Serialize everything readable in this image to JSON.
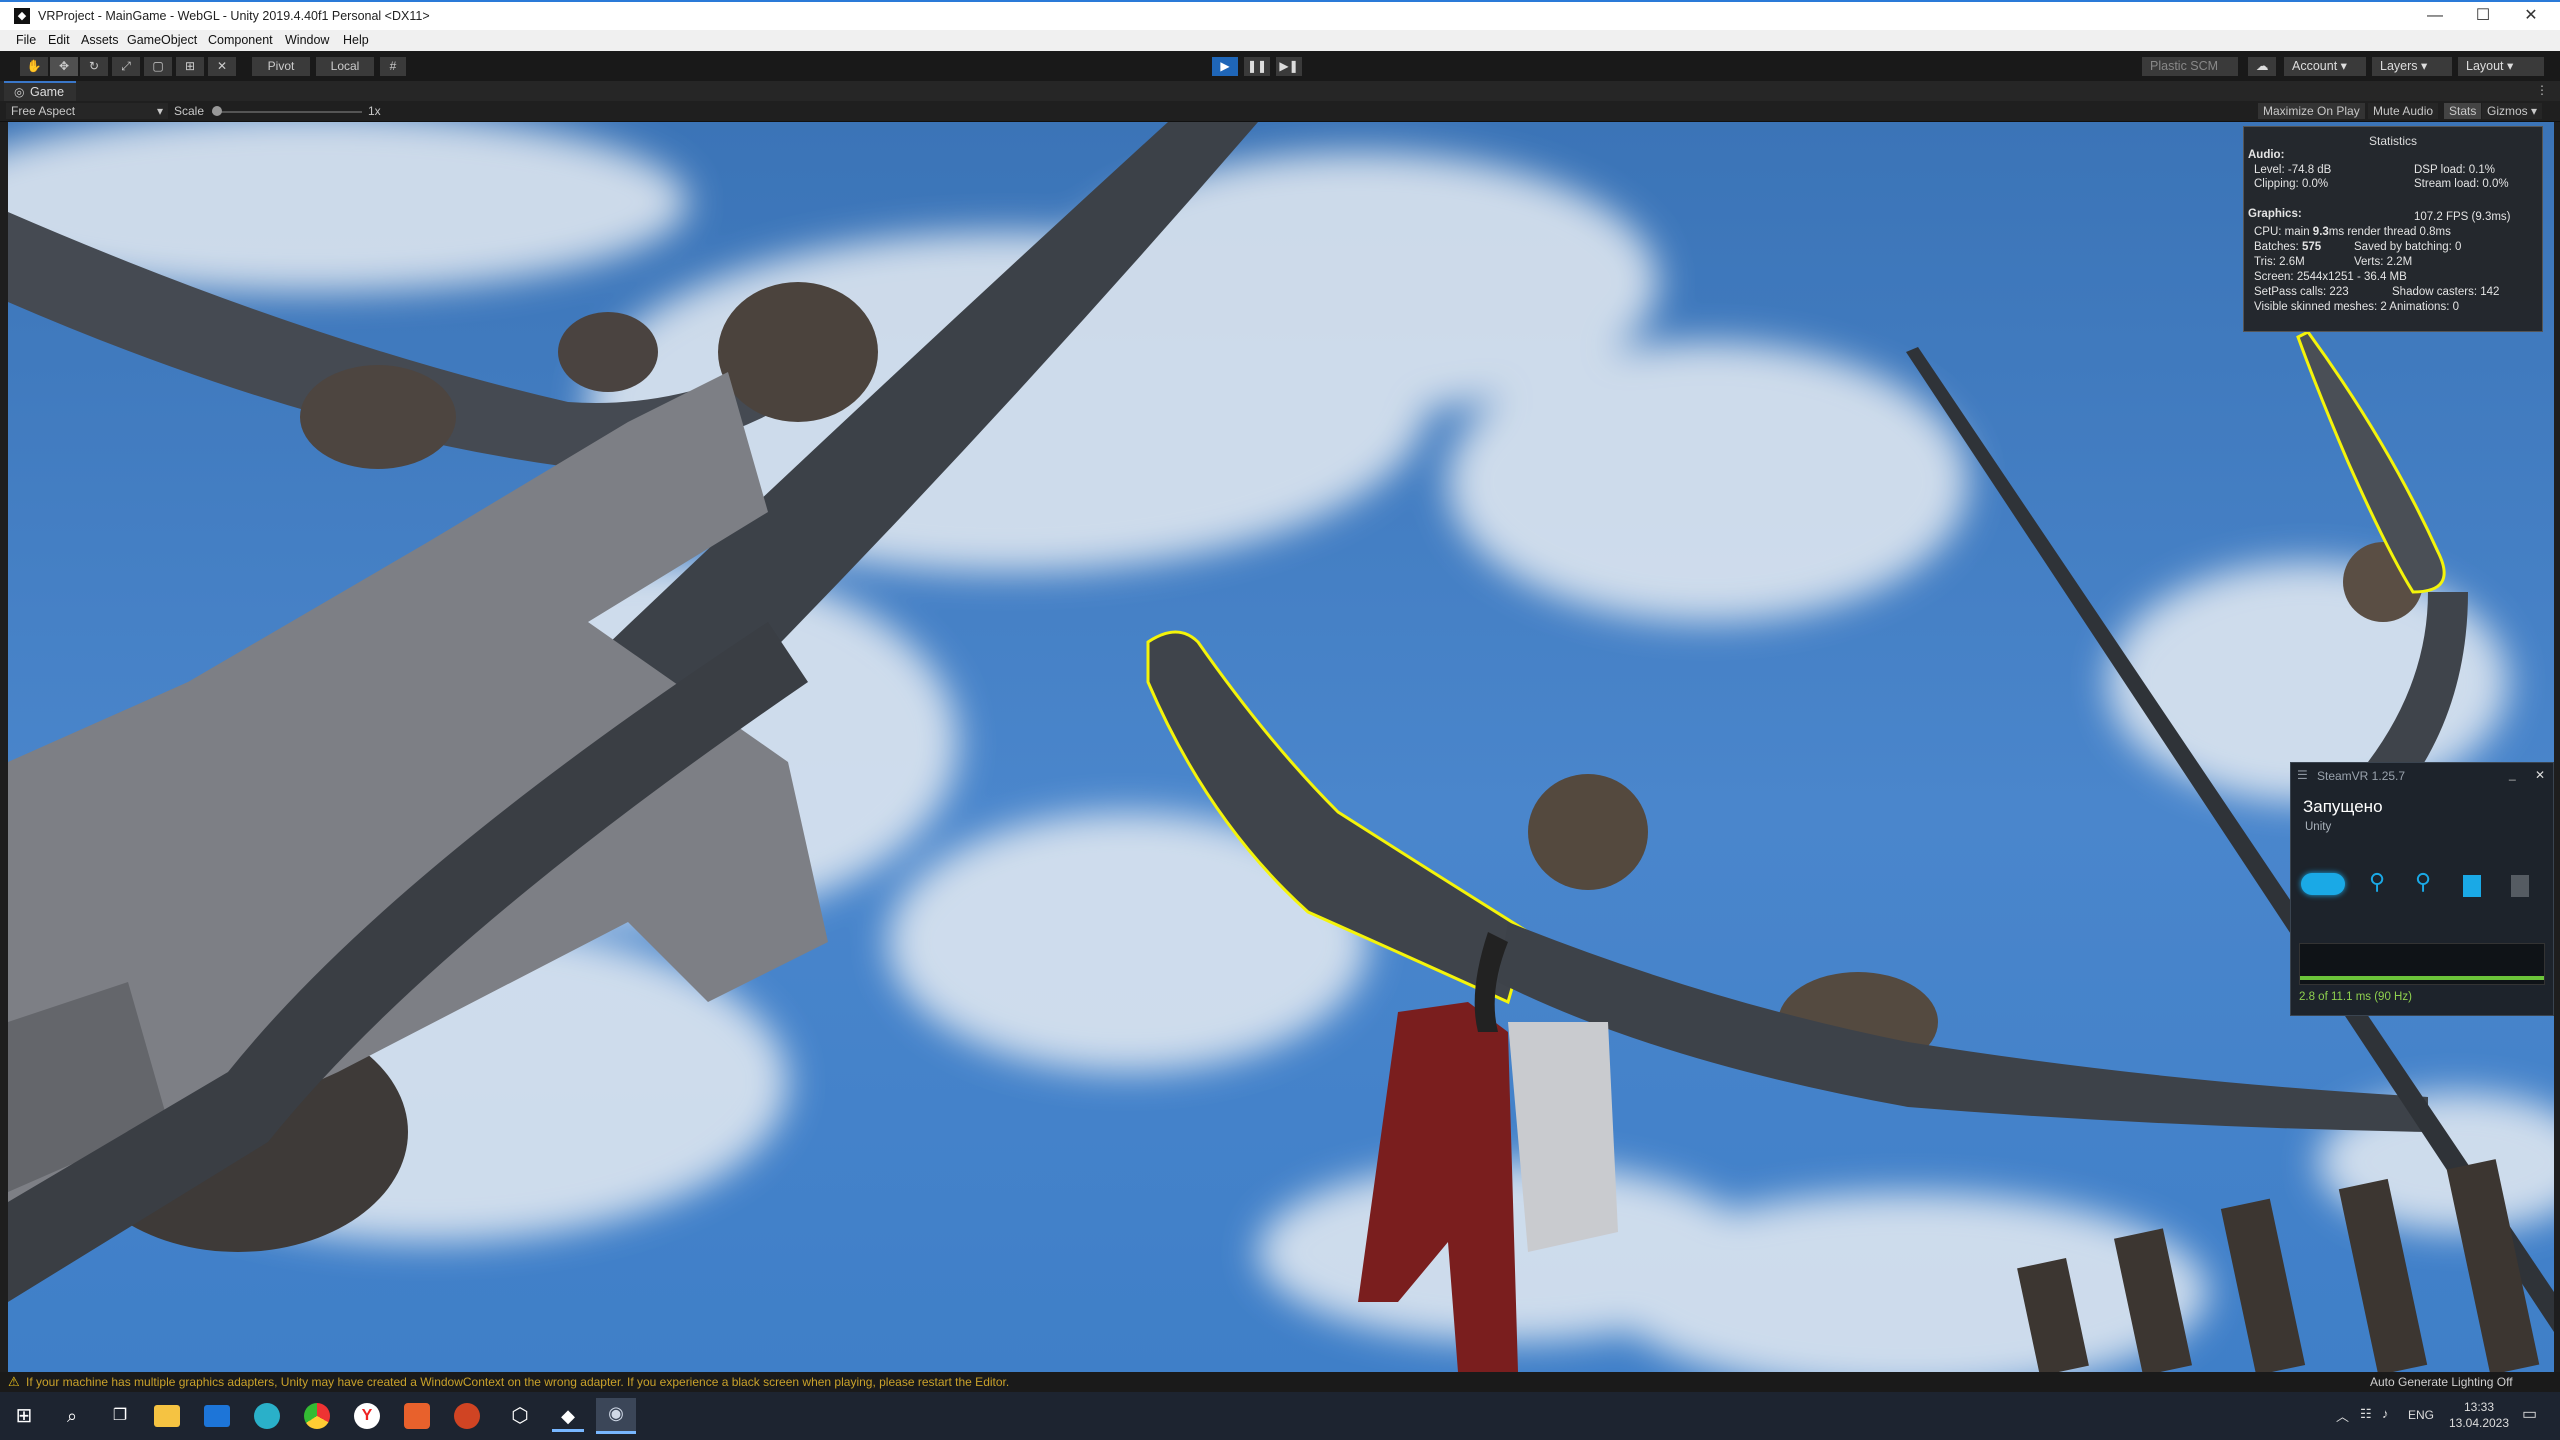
{
  "window": {
    "title": "VRProject - MainGame - WebGL - Unity 2019.4.40f1 Personal <DX11>",
    "controls": {
      "minimize": "—",
      "maximize": "☐",
      "close": "✕"
    }
  },
  "menu": [
    "File",
    "Edit",
    "Assets",
    "GameObject",
    "Component",
    "Window",
    "Help"
  ],
  "toolbar": {
    "pivot": "Pivot",
    "local": "Local",
    "plastic": "Plastic SCM",
    "account": "Account",
    "layers": "Layers",
    "layout": "Layout"
  },
  "game_tab": {
    "label": "Game"
  },
  "game_bar": {
    "aspect": "Free Aspect",
    "scale_label": "Scale",
    "scale_value": "1x",
    "maximize": "Maximize On Play",
    "mute": "Mute Audio",
    "stats": "Stats",
    "gizmos": "Gizmos"
  },
  "stats": {
    "title": "Statistics",
    "audio_header": "Audio:",
    "level": "Level: -74.8 dB",
    "clipping": "Clipping: 0.0%",
    "dsp": "DSP load: 0.1%",
    "stream": "Stream load: 0.0%",
    "graphics_header": "Graphics:",
    "fps": "107.2 FPS (9.3ms)",
    "cpu_prefix": "CPU: main ",
    "cpu_main": "9.3",
    "cpu_suffix": "ms  render thread 0.8ms",
    "batches_prefix": "Batches: ",
    "batches": "575",
    "saved": "Saved by batching: 0",
    "tris": "Tris: 2.6M",
    "verts": "Verts: 2.2M",
    "screen": "Screen: 2544x1251 - 36.4 MB",
    "setpass": "SetPass calls: 223",
    "shadow": "Shadow casters: 142",
    "skinned": "Visible skinned meshes: 2  Animations: 0"
  },
  "steamvr": {
    "title": "SteamVR 1.25.7",
    "status": "Запущено",
    "app": "Unity",
    "timing": "2.8 of 11.1 ms (90 Hz)"
  },
  "statusbar": {
    "warning": "If your machine has multiple graphics adapters, Unity may have created a WindowContext on the wrong adapter. If you experience a black screen when playing, please restart the Editor.",
    "lighting": "Auto Generate Lighting Off"
  },
  "taskbar": {
    "lang": "ENG",
    "time": "13:33",
    "date": "13.04.2023"
  },
  "colors": {
    "accent": "#2a7ad8",
    "outline": "#f4f40a",
    "sky": "#3f7fc8",
    "steam_blue": "#1aa9e6"
  }
}
